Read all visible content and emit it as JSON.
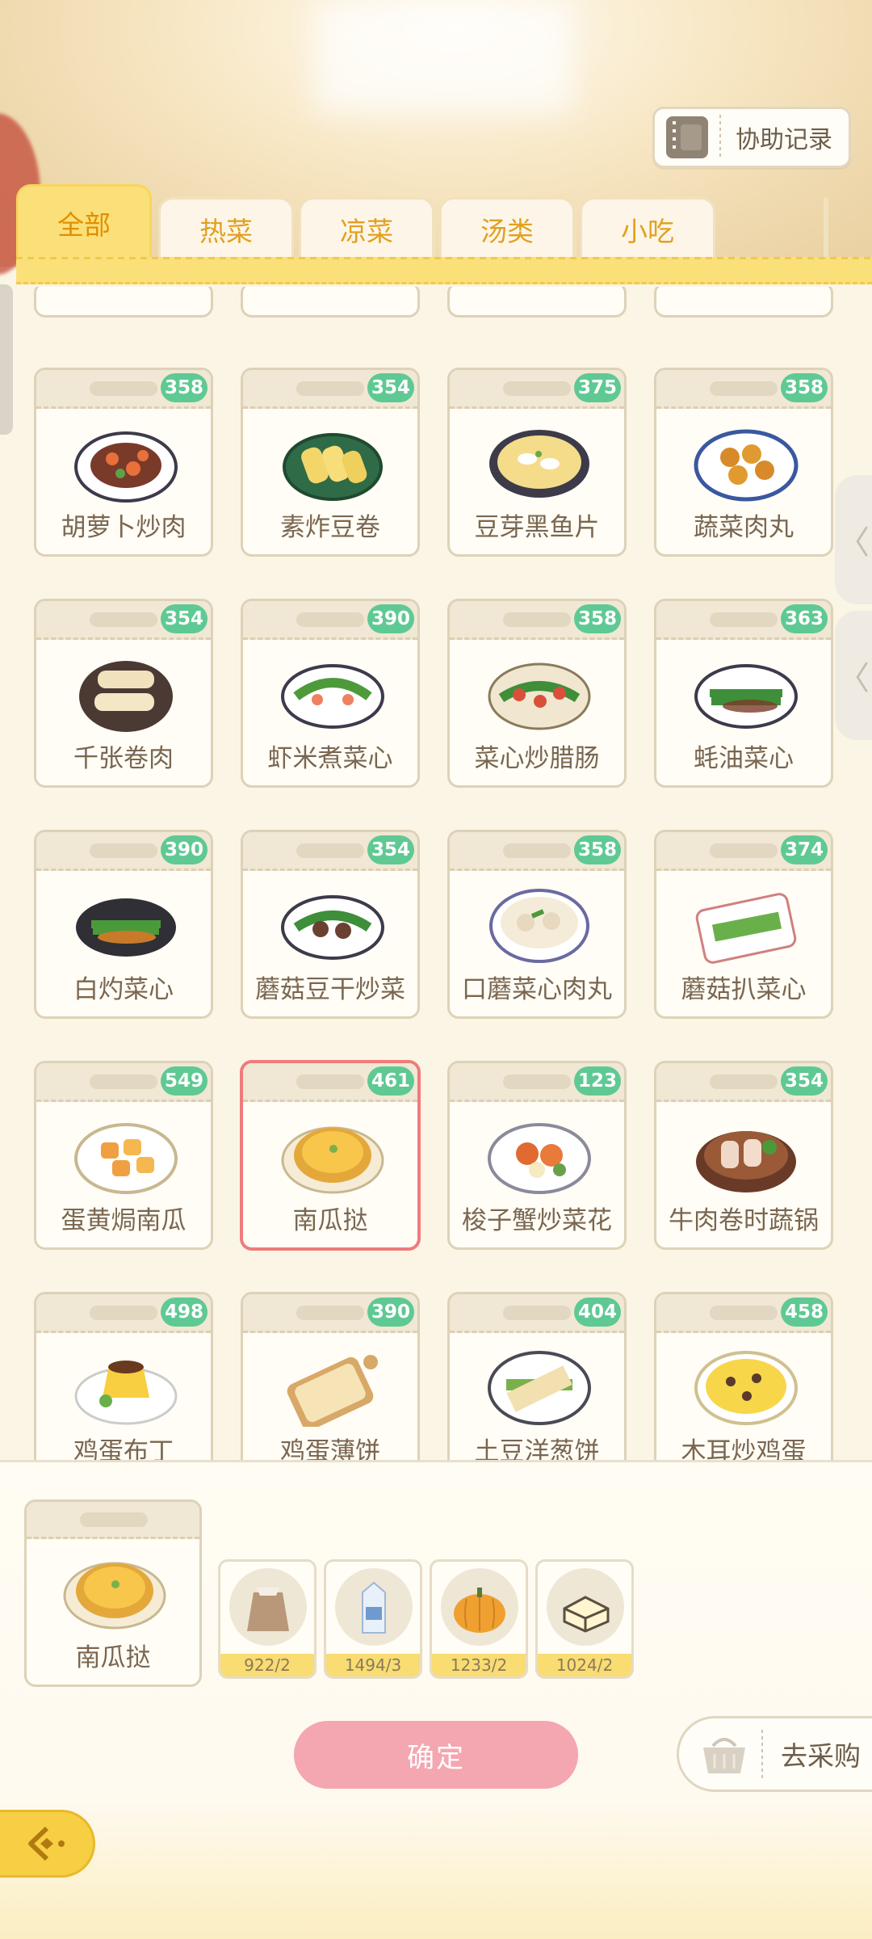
{
  "header": {
    "assist_label": "协助记录"
  },
  "tabs": [
    {
      "label": "全部",
      "active": true
    },
    {
      "label": "热菜",
      "active": false
    },
    {
      "label": "凉菜",
      "active": false
    },
    {
      "label": "汤类",
      "active": false
    },
    {
      "label": "小吃",
      "active": false
    }
  ],
  "dishes": [
    {
      "name": "胡萝卜炒肉",
      "count": "358"
    },
    {
      "name": "素炸豆卷",
      "count": "354"
    },
    {
      "name": "豆芽黑鱼片",
      "count": "375"
    },
    {
      "name": "蔬菜肉丸",
      "count": "358"
    },
    {
      "name": "千张卷肉",
      "count": "354"
    },
    {
      "name": "虾米煮菜心",
      "count": "390"
    },
    {
      "name": "菜心炒腊肠",
      "count": "358"
    },
    {
      "name": "蚝油菜心",
      "count": "363"
    },
    {
      "name": "白灼菜心",
      "count": "390"
    },
    {
      "name": "蘑菇豆干炒菜",
      "count": "354"
    },
    {
      "name": "口蘑菜心肉丸",
      "count": "358"
    },
    {
      "name": "蘑菇扒菜心",
      "count": "374"
    },
    {
      "name": "蛋黄焗南瓜",
      "count": "549"
    },
    {
      "name": "南瓜挞",
      "count": "461"
    },
    {
      "name": "梭子蟹炒菜花",
      "count": "123"
    },
    {
      "name": "牛肉卷时蔬锅",
      "count": "354"
    },
    {
      "name": "鸡蛋布丁",
      "count": "498"
    },
    {
      "name": "鸡蛋薄饼",
      "count": "390"
    },
    {
      "name": "土豆洋葱饼",
      "count": "404"
    },
    {
      "name": "木耳炒鸡蛋",
      "count": "458"
    }
  ],
  "selected": {
    "name": "南瓜挞"
  },
  "ingredients": [
    {
      "icon": "flour-sack-icon",
      "count": "922/2"
    },
    {
      "icon": "milk-carton-icon",
      "count": "1494/3"
    },
    {
      "icon": "pumpkin-icon",
      "count": "1233/2"
    },
    {
      "icon": "butter-icon",
      "count": "1024/2"
    }
  ],
  "actions": {
    "confirm_label": "确定",
    "buy_label": "去采购"
  },
  "colors": {
    "accent": "#fbe07a",
    "badge": "#5fc993",
    "confirm": "#f4a6b1",
    "selected_border": "#ef7b7b"
  }
}
